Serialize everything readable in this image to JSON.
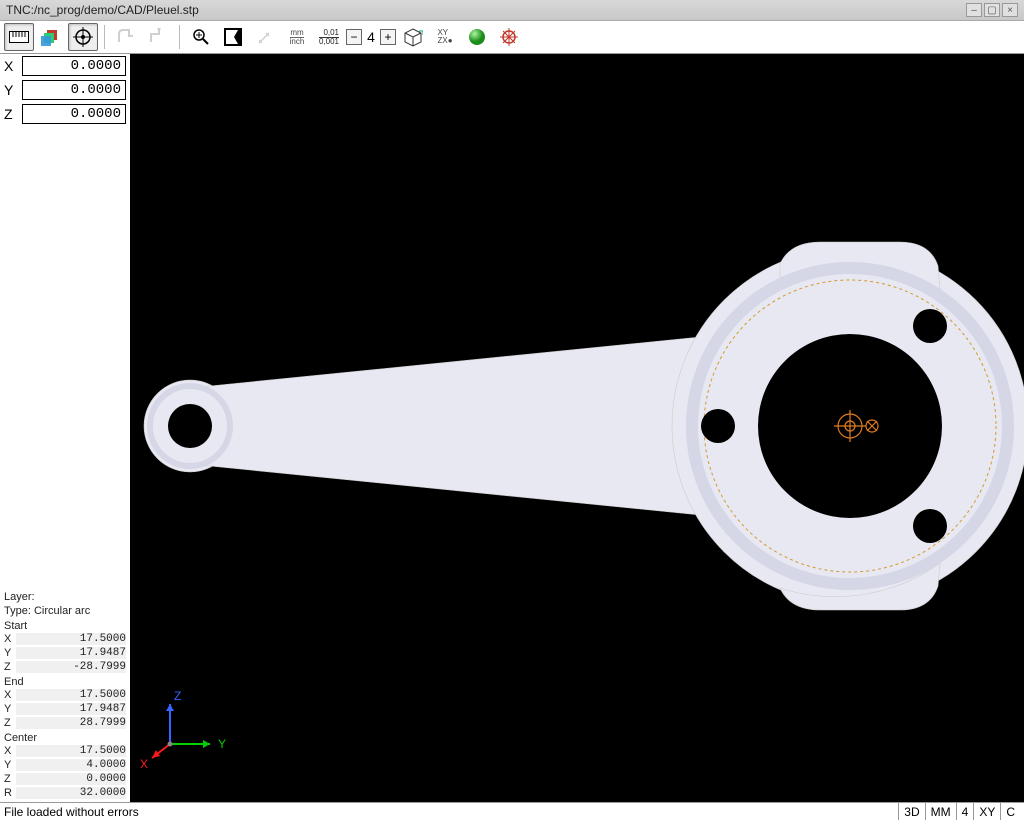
{
  "window": {
    "title": "TNC:/nc_prog/demo/CAD/Pleuel.stp"
  },
  "toolbar": {
    "mmInch": {
      "top": "mm",
      "bot": "inch"
    },
    "precision": {
      "l1": "0,01",
      "l2": "0,001"
    },
    "stepValue": "4",
    "xyPanel": {
      "top": "XY",
      "bot": "ZX●"
    }
  },
  "coords": {
    "x": {
      "label": "X",
      "value": "0.0000"
    },
    "y": {
      "label": "Y",
      "value": "0.0000"
    },
    "z": {
      "label": "Z",
      "value": "0.0000"
    }
  },
  "info": {
    "layerLabel": "Layer:",
    "layerValue": "",
    "typeLabel": "Type:",
    "typeValue": "Circular arc",
    "startLabel": "Start",
    "start": {
      "x": "17.5000",
      "y": "17.9487",
      "z": "-28.7999"
    },
    "endLabel": "End",
    "end": {
      "x": "17.5000",
      "y": "17.9487",
      "z": "28.7999"
    },
    "centerLabel": "Center",
    "center": {
      "x": "17.5000",
      "y": "4.0000",
      "z": "0.0000",
      "r": "32.0000"
    },
    "axis": {
      "x": "X",
      "y": "Y",
      "z": "Z",
      "r": "R"
    }
  },
  "triad": {
    "x": "Y",
    "y": "Z",
    "z": "X"
  },
  "status": {
    "message": "File loaded without errors",
    "cells": [
      "3D",
      "MM",
      "4",
      "XY",
      "C"
    ]
  }
}
